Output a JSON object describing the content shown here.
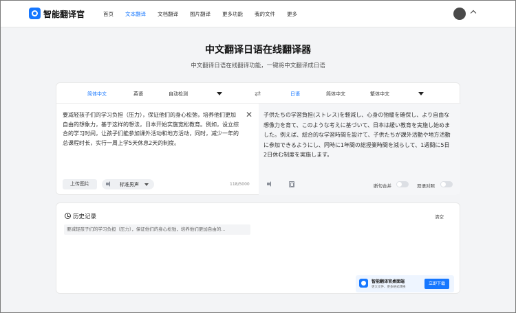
{
  "brand": {
    "name": "智能翻译官"
  },
  "nav": [
    "首页",
    "文本翻译",
    "文档翻译",
    "图片翻译",
    "更多功能",
    "我的文件",
    "更多"
  ],
  "page": {
    "title": "中文翻译日语在线翻译器",
    "subtitle": "中文翻译日语在线翻译功能，一键将中文翻译成日语"
  },
  "translator": {
    "source_langs": [
      "简体中文",
      "英语",
      "自动检测"
    ],
    "target_langs": [
      "日语",
      "简体中文",
      "繁体中文"
    ],
    "source_text": "要减轻孩子们的学习负担（压力），保证他们的身心松弛，培养他们更加自由的想象力，基于这样的想法，日本开始实施宽松教育。例如，设立综合的学习时间，让孩子们能参加课外活动和地方活动，同时，减少一年的总课程时长，实行一周上学5天休息2天的制度。",
    "target_text": "子供たちの学習負担(ストレス)を軽減し、心身の弛緩を確保し、より自由な想像力を育て、このような考えに基づいて、日本は緩い教育を実施し始めました。例えば、総合的な学習時間を設けて、子供たちが課外活動や地方活動に参加できるようにし、同時に1年間の総授業時間を減らして、1週間に5日2日休む制度を実施します。",
    "upload_label": "上传图片",
    "voice_label": "标准男声",
    "char_count": "118/5000",
    "merge_label": "断句合并",
    "bilingual_label": "双语对照"
  },
  "history": {
    "title": "历史记录",
    "clear_label": "清空",
    "items": [
      "要减轻孩子们的学习负担（压力），保证他们的身心松弛，培养他们更加自由的..."
    ]
  },
  "promo": {
    "title": "智能翻译官桌面端",
    "subtitle": "更大文件、更多格式转换",
    "button": "立即下载"
  },
  "colors": {
    "accent": "#1677ff",
    "background": "#f3f4f6"
  },
  "icons": [
    "logo-icon",
    "avatar",
    "chevron-up-icon",
    "swap-icon",
    "close-icon",
    "speaker-icon",
    "copy-icon",
    "history-icon",
    "dropdown-icon"
  ]
}
